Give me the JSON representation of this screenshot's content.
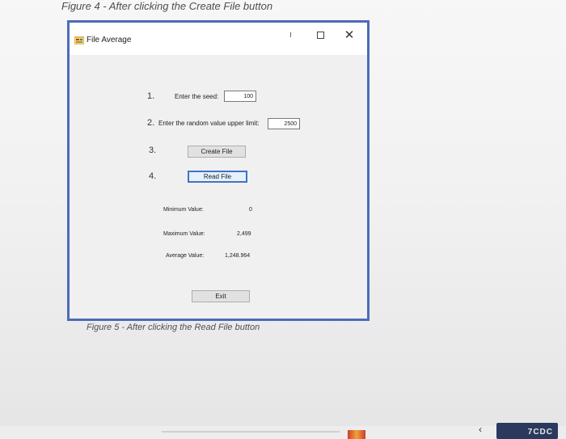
{
  "captions": {
    "top": "Figure 4 - After clicking the Create File button",
    "bottom": "Figure 5 - After clicking the Read File button"
  },
  "window": {
    "title": "File Average",
    "icon": "app-form-icon",
    "controls": {
      "minimize": "minimize-icon",
      "maximize": "maximize-icon",
      "close": "close-icon",
      "close_glyph": "✕"
    }
  },
  "form": {
    "step1": {
      "number": "1.",
      "label": "Enter the seed:",
      "value": "100"
    },
    "step2": {
      "number": "2.",
      "label": "Enter the random value upper limit:",
      "value": "2500"
    },
    "step3": {
      "number": "3.",
      "button": "Create File"
    },
    "step4": {
      "number": "4.",
      "button": "Read File"
    },
    "results": {
      "minimum_label": "Minimum Value:",
      "minimum_value": "0",
      "maximum_label": "Maximum Value:",
      "maximum_value": "2,499",
      "average_label": "Average Value:",
      "average_value": "1,248.964"
    },
    "exit_button": "Exit"
  },
  "taskbar": {
    "badge_text": "7CDC"
  },
  "colors": {
    "window_border": "#4d6cb8",
    "focus_border": "#3f74c8"
  }
}
